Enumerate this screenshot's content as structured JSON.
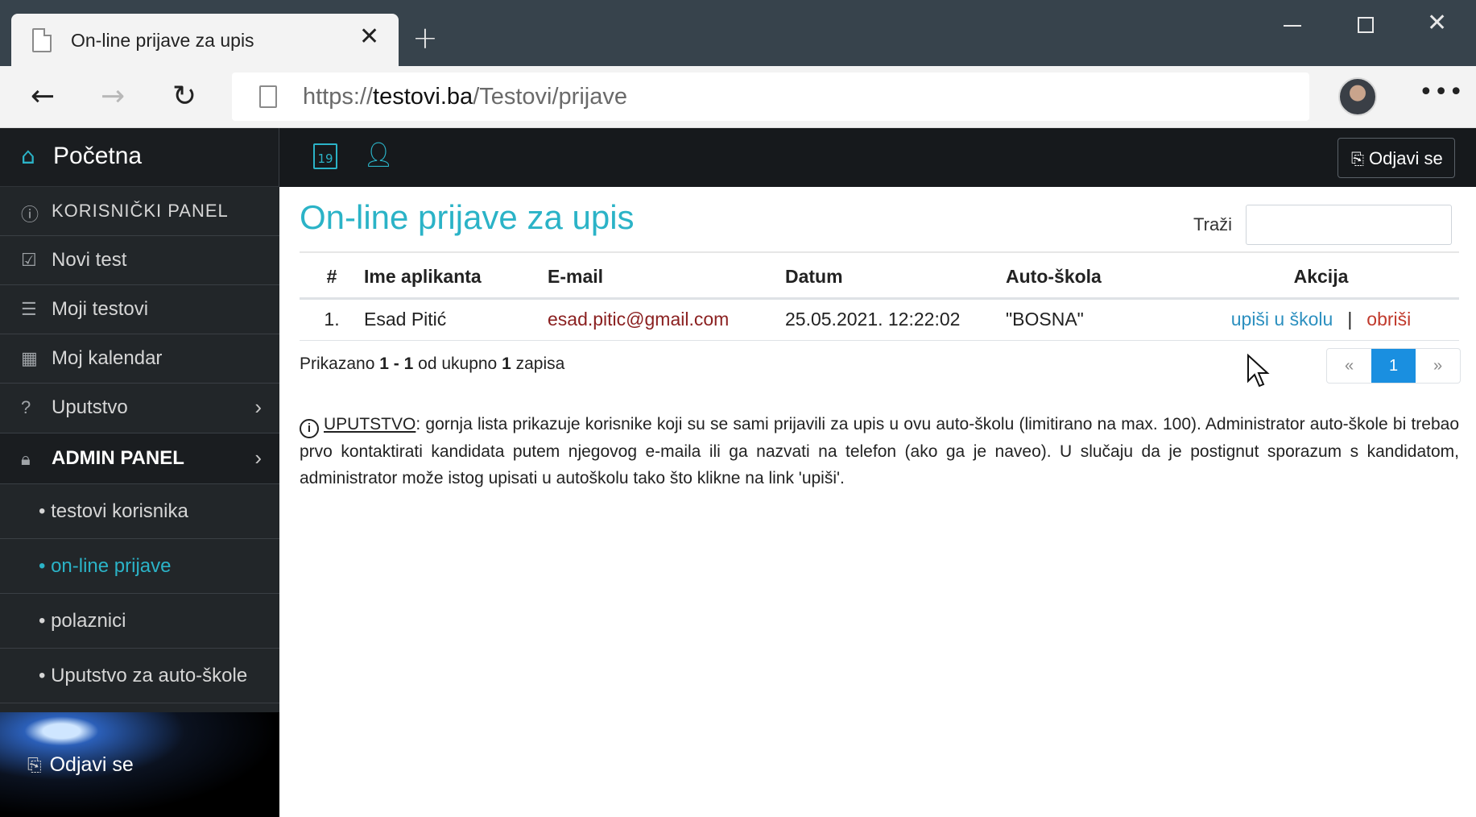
{
  "browser": {
    "tab_title": "On-line prijave za upis",
    "tab_close": "✕",
    "new_tab": "+",
    "url_scheme": "https://",
    "url_domain": "testovi.ba",
    "url_path": "/Testovi/prijave",
    "icons": [
      "doc-icon",
      "back-arrow-icon",
      "forward-arrow-icon",
      "refresh-icon",
      "more-icon",
      "avatar"
    ]
  },
  "sidebar": {
    "brand": "Početna",
    "items": [
      {
        "label": "KORISNIČKI PANEL",
        "icon": "info-icon"
      },
      {
        "label": "Novi test",
        "icon": "checkbox-icon"
      },
      {
        "label": "Moji testovi",
        "icon": "list-icon"
      },
      {
        "label": "Moj kalendar",
        "icon": "grid-icon"
      },
      {
        "label": "Uputstvo",
        "icon": "help-icon",
        "chevron": "›"
      },
      {
        "label": "ADMIN PANEL",
        "icon": "lock-icon",
        "chevron": "›"
      }
    ],
    "subitems": [
      {
        "label": "• testovi korisnika"
      },
      {
        "label": "• on-line prijave",
        "active": true
      },
      {
        "label": "• polaznici"
      },
      {
        "label": "• Uputstvo za auto-škole"
      }
    ],
    "logout": "Odjavi se"
  },
  "topbar": {
    "calendar_day": "19",
    "logout": "Odjavi se"
  },
  "main": {
    "title": "On-line prijave za upis",
    "search_label": "Traži",
    "search_value": "",
    "columns": [
      "#",
      "Ime aplikanta",
      "E-mail",
      "Datum",
      "Auto-škola",
      "Akcija"
    ],
    "rows": [
      {
        "num": "1.",
        "name": "Esad Pitić",
        "email": "esad.pitic@gmail.com",
        "date": "25.05.2021. 12:22:02",
        "school": "\"BOSNA\"",
        "action_enroll": "upiši u školu",
        "action_sep": "|",
        "action_delete": "obriši"
      }
    ],
    "summary_prefix": "Prikazano",
    "summary_from": "1",
    "summary_dash": "-",
    "summary_to": "1",
    "summary_mid": "od ukupno",
    "summary_total": "1",
    "summary_suffix": "zapisa",
    "pager": {
      "prev": "«",
      "current": "1",
      "next": "»"
    },
    "info_label": "UPUTSTVO",
    "info_text": ": gornja lista prikazuje korisnike koji su se sami prijavili za upis u ovu auto-školu (limitirano na max. 100). Administrator auto-škole bi trebao prvo kontaktirati kandidata putem njegovog e-maila ili ga nazvati na telefon (ako ga je naveo). U slučaju da je postignut sporazum s kandidatom, administrator može istog upisati u autoškolu tako što klikne na link 'upiši'."
  },
  "colors": {
    "accent": "#2bb3c7",
    "sidebar_bg": "#222629",
    "topbar_bg": "#16191c",
    "email": "#8a1f1f",
    "delete": "#c0392b",
    "enroll": "#2b8fbf",
    "pager_active": "#1a8fe0"
  }
}
